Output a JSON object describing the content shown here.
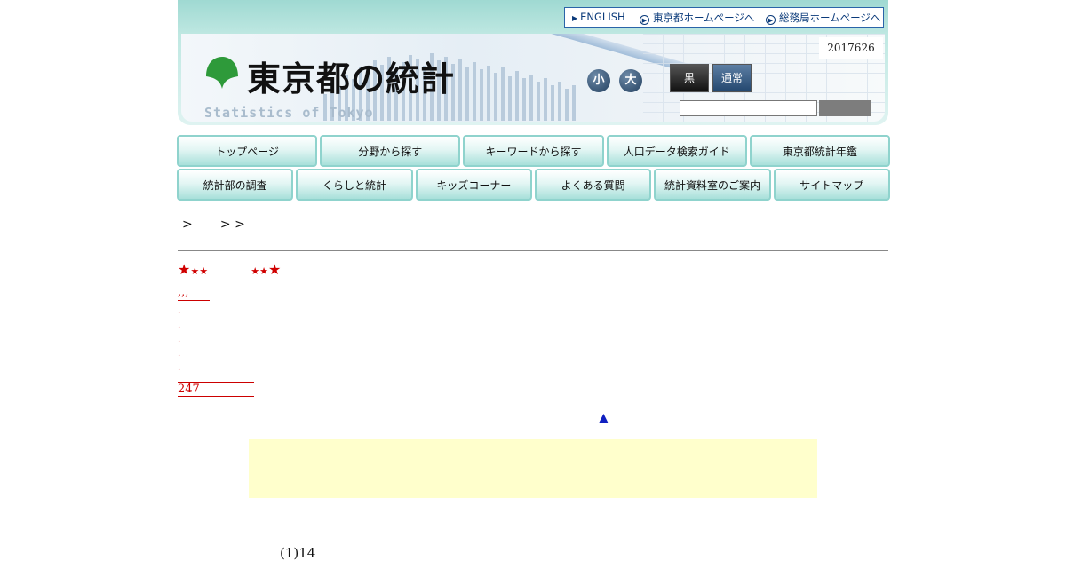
{
  "header": {
    "top_links": {
      "english": "ENGLISH",
      "tokyo_home": "東京都ホームページへ",
      "soumu_home": "総務局ホームページへ"
    },
    "logo_title": "東京都の統計",
    "logo_subtitle": "Statistics of Tokyo",
    "date": "2017626",
    "font_size": {
      "small": "小",
      "large": "大"
    },
    "color_mode": {
      "black": "黒",
      "normal": "通常"
    },
    "search": {
      "placeholder": "",
      "button_label": ""
    },
    "colors": {
      "logo_green": "#2e9a3a",
      "header_teal": "#9fd9d2",
      "nav_border": "#8fd3cd"
    }
  },
  "nav": {
    "row1": [
      "トップページ",
      "分野から探す",
      "キーワードから探す",
      "人口データ検索ガイド",
      "東京都統計年鑑"
    ],
    "row2": [
      "統計部の調査",
      "くらしと統計",
      "キッズコーナー",
      "よくある質問",
      "統計資料室のご案内",
      "サイトマップ"
    ]
  },
  "content": {
    "breadcrumb": ">       > >",
    "stars_left_big": "★",
    "stars_left_small": "★★",
    "stars_right_small": "★★",
    "stars_right_big": "★",
    "link1": ",,,",
    "dots": [
      ".",
      ".",
      ".",
      ".",
      "."
    ],
    "link2": "",
    "link3": "247",
    "back_to_top": "▲",
    "section_heading": "(1)14"
  }
}
